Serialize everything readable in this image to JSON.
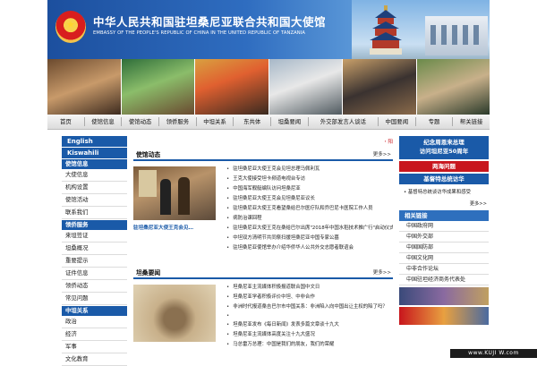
{
  "header": {
    "title_cn": "中华人民共和国驻坦桑尼亚联合共和国大使馆",
    "title_en": "EMBASSY OF THE PEOPLE'S REPUBLIC OF CHINA IN THE UNITED REPUBLIC OF TANZANIA"
  },
  "nav": [
    "首页",
    "使馆信息",
    "使馆动态",
    "领侨服务",
    "中坦关系",
    "东共体",
    "坦桑要闻",
    "外交部发言人谈话",
    "中国要闻",
    "专题",
    "帮关链接"
  ],
  "left": {
    "lang_buttons": [
      "English",
      "Kiswahili"
    ],
    "sections": [
      {
        "title": "使馆信息",
        "items": [
          "大使信息",
          "机构设置",
          "使馆活动",
          "联系我们"
        ]
      },
      {
        "title": "领侨服务",
        "items": [
          "来坦签证",
          "坦桑概况",
          "重要提示",
          "证件信息",
          "领侨动态",
          "常见问题"
        ]
      },
      {
        "title": "中坦关系",
        "items": [
          "政治",
          "经济",
          "军事",
          "文化教育"
        ]
      }
    ]
  },
  "center": {
    "red_tag": "・阳",
    "sec1": {
      "title": "使馆动态",
      "more": "更多>>",
      "caption": "驻坦桑尼亚大使王克会见…",
      "items": [
        "驻坦桑尼亚大使王克会见坦总理马佩利瓦",
        "王克大使接受坦卡频道电视台专访",
        "中国海军舰艇编队访问坦桑尼亚",
        "驻坦桑尼亚大使王克会见坦桑尼亚议长",
        "驻坦桑尼亚大使王克看望桑给巴尔医疗队和乔巴尼卡医院工作人员",
        "病防治课回程",
        "驻坦桑尼亚大使王克在桑给巴尔出席\"2018年中国水稻技术推广行\"启动仪式",
        "中坦双方清明节共同祭扫援坦桑尼亚中国专家公墓",
        "驻坦桑尼亚使馆举办介绍华侨华人公共外交志愿者联谊会"
      ]
    },
    "sec2": {
      "title": "坦桑要闻",
      "more": "更多>>",
      "items": [
        "坦桑尼亚主流媒体积极报道联合国中文日",
        "坦桑尼亚学者积极评价中坦、中非合作",
        "非洲时代报道桑吉巴尔市中国关系：非洲陷入向中国出让主权的陷了吗？",
        "坦桑尼亚发布《每日新闻》发表多篇文章谈十九大",
        "坦桑尼亚主流媒体高度关注十九大盛况",
        "马总雷万总理：中国是我们的朋友，我们的荣耀"
      ]
    }
  },
  "right": {
    "banner1": [
      "纪念周恩来总理",
      "访问坦尼亚50周年"
    ],
    "banner2": "两海问题",
    "banner3": "基督特总统访华",
    "item": "基督特总统谈访华成果和感受",
    "more": "更多>>",
    "links_title": "相关链接",
    "links": [
      "中国政府网",
      "中国外交部",
      "中国国防部",
      "中国文化网",
      "中非合作论坛",
      "中国驻坦经济商务代表处"
    ]
  },
  "watermark": "www.KUJI W.com"
}
